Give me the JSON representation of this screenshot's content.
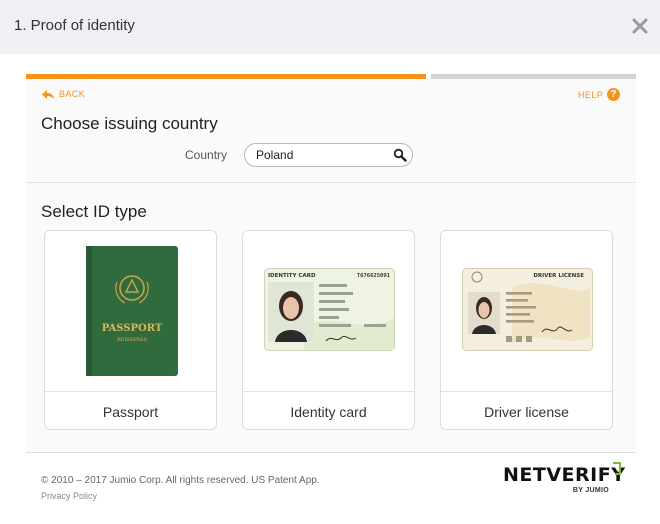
{
  "dialog": {
    "title": "1. Proof of identity",
    "close_icon": "close-icon"
  },
  "progress": {
    "value": 0.66,
    "done_color": "#f7941d",
    "todo_color": "#d4d4d4"
  },
  "nav": {
    "back_label": "BACK",
    "help_label": "HELP",
    "help_glyph": "?"
  },
  "country_section": {
    "heading": "Choose issuing country",
    "field_label": "Country",
    "value": "Poland"
  },
  "id_section": {
    "heading": "Select ID type",
    "options": [
      {
        "label": "Passport",
        "icon": "passport-image",
        "image_title": "PASSPORT",
        "image_subtitle": "REISEPASS"
      },
      {
        "label": "Identity card",
        "icon": "identity-card-image",
        "image_title": "IDENTITY CARD",
        "image_number": "T676625091"
      },
      {
        "label": "Driver license",
        "icon": "driver-license-image",
        "image_title": "DRIVER LICENSE"
      }
    ]
  },
  "footer": {
    "copyright": "© 2010 – 2017 Jumio Corp. All rights reserved. US Patent App.",
    "privacy_label": "Privacy Policy",
    "logo_word": "NETVERIFY",
    "logo_by": "BY JUMIO"
  },
  "colors": {
    "accent": "#f7941d",
    "passport_green": "#2f6b3c"
  }
}
